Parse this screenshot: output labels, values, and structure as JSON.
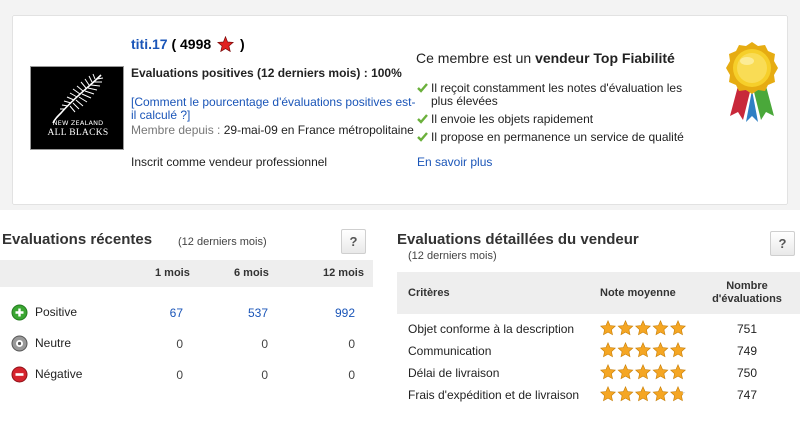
{
  "profile": {
    "username": "titi.17",
    "score_open": "( 4998",
    "score_close": ")",
    "logo": {
      "line1": "NEW ZEALAND",
      "line2": "ALL BLACKS"
    },
    "positive_eval": "Evaluations positives (12 derniers mois) : 100%",
    "how_calculated_link": "[Comment le pourcentage d'évaluations positives est-il calculé ?]",
    "member_since_label": "Membre depuis :",
    "member_since_value": "29-mai-09 en France métropolitaine",
    "pro_seller": "Inscrit comme vendeur professionnel"
  },
  "top_seller": {
    "title_prefix": "Ce membre est un",
    "title_bold": "vendeur Top Fiabilité",
    "benefits": [
      "Il reçoit constamment les notes d'évaluation les plus élevées",
      "Il envoie les objets rapidement",
      "Il propose en permanence un service de qualité"
    ],
    "learn_more": "En savoir plus",
    "colors": {
      "check": "#6bb03c",
      "medal_gold": "#f2c21a",
      "ribbon_green": "#4aa83a",
      "ribbon_red": "#c8283a"
    }
  },
  "recent": {
    "title": "Evaluations récentes",
    "subtitle": "(12 derniers mois)",
    "help": "?",
    "columns": [
      "1 mois",
      "6 mois",
      "12 mois"
    ],
    "rows": [
      {
        "label": "Positive",
        "icon": "plus-circle-icon",
        "values": [
          "67",
          "537",
          "992"
        ]
      },
      {
        "label": "Neutre",
        "icon": "neutral-circle-icon",
        "values": [
          "0",
          "0",
          "0"
        ]
      },
      {
        "label": "Négative",
        "icon": "minus-circle-icon",
        "values": [
          "0",
          "0",
          "0"
        ]
      }
    ]
  },
  "detailed": {
    "title": "Evaluations détaillées du vendeur",
    "subtitle": "(12 derniers mois)",
    "help": "?",
    "columns": [
      "Critères",
      "Note moyenne",
      "Nombre d'évaluations"
    ],
    "rows": [
      {
        "criterion": "Objet conforme à la description",
        "rating": 5,
        "count": "751"
      },
      {
        "criterion": "Communication",
        "rating": 5,
        "count": "749"
      },
      {
        "criterion": "Délai de livraison",
        "rating": 5,
        "count": "750"
      },
      {
        "criterion": "Frais d'expédition et de livraison",
        "rating": 4.8,
        "count": "747"
      }
    ],
    "star_color": "#f5a623"
  }
}
